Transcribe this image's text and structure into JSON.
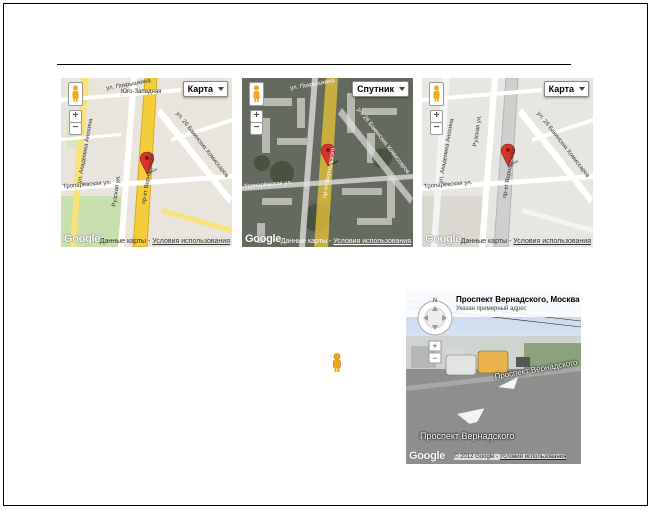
{
  "maps": [
    {
      "type_label": "Карта",
      "theme": "map",
      "streets": [
        "Юго-Западная",
        "ул. Покрышкина",
        "ул. Академика Анохина",
        "Тропарёвская ул.",
        "Рузская ул.",
        "пр-кт Вернадского",
        "ул. 26 Бакинских Комиссаров"
      ],
      "footer_data": "Данные карты",
      "footer_terms": "Условия использования",
      "logo": "Google"
    },
    {
      "type_label": "Спутник",
      "theme": "satellite",
      "streets": [
        "ул. Покрышкина",
        "ул. 26 Бакинских Комиссаров",
        "Тропарёвская ул.",
        "пр-кт Вернадского"
      ],
      "footer_data": "Данные карты",
      "footer_terms": "Условия использования",
      "logo": "Google"
    },
    {
      "type_label": "Карта",
      "theme": "map-gray",
      "streets": [
        "ул. Академика Анохина",
        "Рузская ул.",
        "ул. 26 Бакинских Комиссаров",
        "Тропарёвская ул.",
        "пр-кт Вернадского"
      ],
      "footer_data": "Данные карты",
      "footer_terms": "Условия использования",
      "logo": "Google"
    }
  ],
  "streetview": {
    "title": "Проспект Вернадского, Москва",
    "subtitle": "Указан примерный адрес",
    "label_upper": "Проспект Вернадского",
    "label_lower": "Проспект Вернадского",
    "copyright": "© 2012 Google",
    "terms": "Условия использования",
    "logo": "Google"
  },
  "colors": {
    "map_bg": "#e9e5dc",
    "road_yellow": "#f5cd3b",
    "road_white": "#ffffff",
    "park_green": "#c8dfae",
    "satellite_bg": "#6f7368",
    "marker_red": "#d8342b",
    "pegman_orange": "#f2a917"
  }
}
